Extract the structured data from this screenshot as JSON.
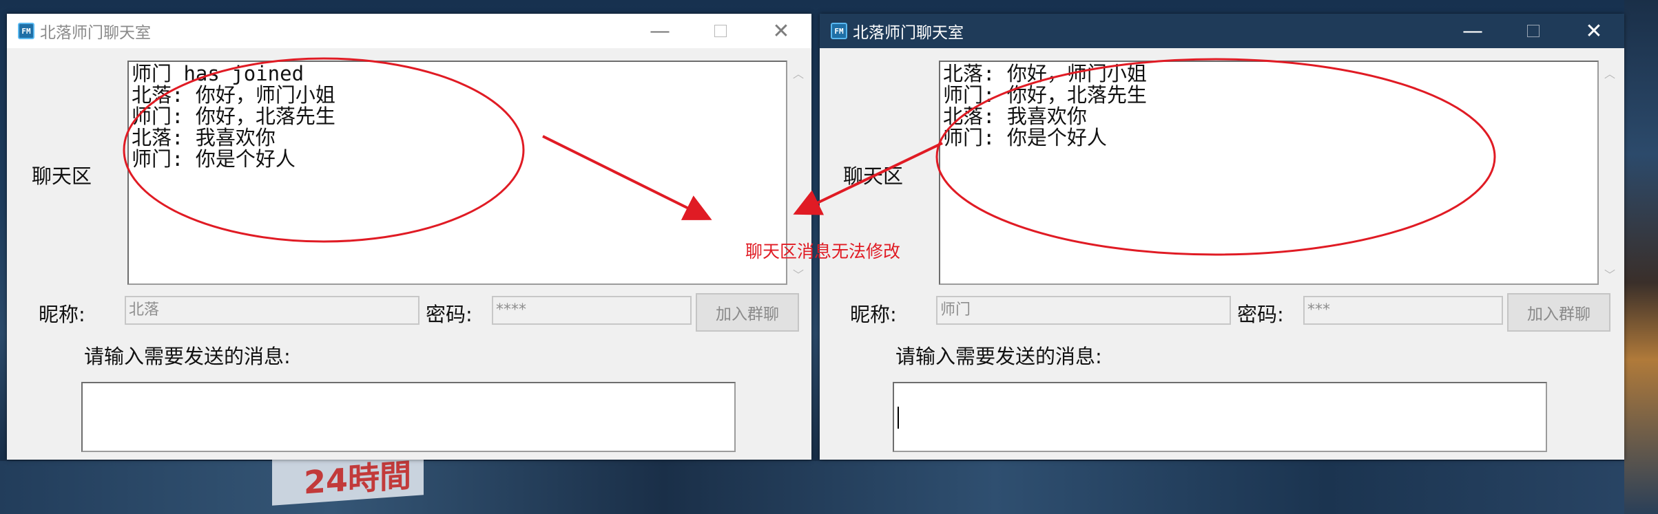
{
  "wallpaper": {
    "sign_text": "24時間"
  },
  "windows": [
    {
      "title": "北落师门聊天室",
      "app_icon": "FM",
      "chat_label": "聊天区",
      "chat_lines": [
        "师门 has joined",
        "北落: 你好，师门小姐",
        "师门: 你好，北落先生",
        "北落: 我喜欢你",
        "师门: 你是个好人"
      ],
      "nickname_label": "昵称:",
      "nickname_value": "北落",
      "password_label": "密码:",
      "password_value": "****",
      "join_button": "加入群聊",
      "prompt": "请输入需要发送的消息:",
      "message_value": ""
    },
    {
      "title": "北落师门聊天室",
      "app_icon": "FM",
      "chat_label": "聊天区",
      "chat_lines": [
        "北落: 你好，师门小姐",
        "师门: 你好，北落先生",
        "北落: 我喜欢你",
        "师门: 你是个好人"
      ],
      "nickname_label": "昵称:",
      "nickname_value": "师门",
      "password_label": "密码:",
      "password_value": "***",
      "join_button": "加入群聊",
      "prompt": "请输入需要发送的消息:",
      "message_value": ""
    }
  ],
  "annotation": {
    "text": "聊天区消息无法修改",
    "color": "#e01b24"
  },
  "colors": {
    "active_titlebar": "#1f3b59",
    "inactive_titlebar": "#ffffff",
    "window_bg": "#f0f0f0"
  }
}
